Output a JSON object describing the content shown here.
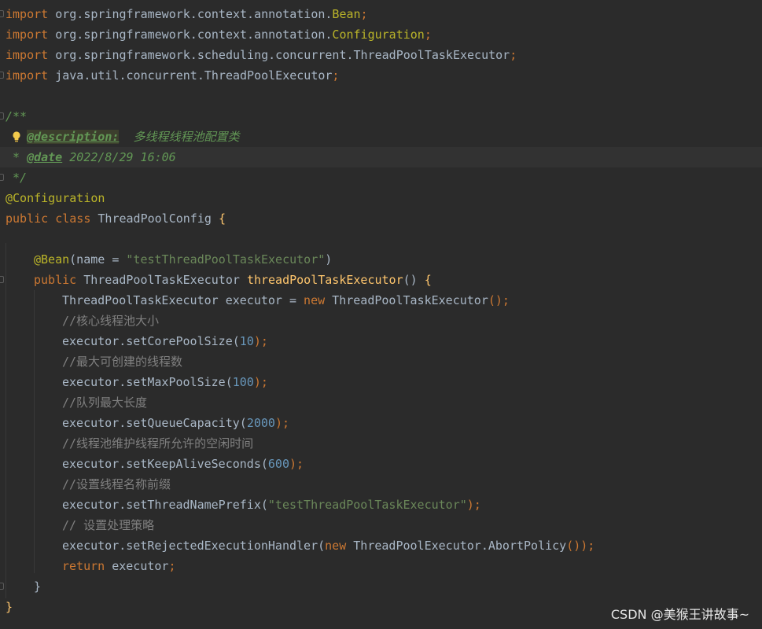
{
  "editor": {
    "language": "java",
    "lines": [
      [
        [
          "import",
          "kw"
        ],
        [
          " org.springframework.context.annotation.",
          "plain"
        ],
        [
          "Bean",
          "ann"
        ],
        [
          ";",
          "punc"
        ]
      ],
      [
        [
          "import",
          "kw"
        ],
        [
          " org.springframework.context.annotation.",
          "plain"
        ],
        [
          "Configuration",
          "ann"
        ],
        [
          ";",
          "punc"
        ]
      ],
      [
        [
          "import",
          "kw"
        ],
        [
          " org.springframework.scheduling.concurrent.ThreadPoolTaskExecutor",
          "plain"
        ],
        [
          ";",
          "punc"
        ]
      ],
      [
        [
          "import",
          "kw"
        ],
        [
          " java.util.concurrent.ThreadPoolExecutor",
          "plain"
        ],
        [
          ";",
          "punc"
        ]
      ],
      [],
      [
        [
          "/**",
          "doc"
        ]
      ],
      [
        [
          "@description:",
          "doctag boxed"
        ],
        [
          "  多线程线程池配置类",
          "doc"
        ]
      ],
      [
        [
          "* ",
          "doc"
        ],
        [
          "@date",
          "doctag"
        ],
        [
          " 2022/8/29 16:06",
          "doc"
        ]
      ],
      [
        [
          "*/",
          "doc"
        ]
      ],
      [
        [
          "@Configuration",
          "ann"
        ]
      ],
      [
        [
          "public class ",
          "kw"
        ],
        [
          "ThreadPoolConfig ",
          "plain"
        ],
        [
          "{",
          "fn"
        ]
      ],
      [],
      [
        [
          "@Bean",
          "ann"
        ],
        [
          "(name = ",
          "plain"
        ],
        [
          "\"testThreadPoolTaskExecutor\"",
          "str"
        ],
        [
          ")",
          "plain"
        ]
      ],
      [
        [
          "public ",
          "kw"
        ],
        [
          "ThreadPoolTaskExecutor ",
          "plain"
        ],
        [
          "threadPoolTaskExecutor",
          "fn"
        ],
        [
          "() ",
          "plain"
        ],
        [
          "{",
          "fn"
        ]
      ],
      [
        [
          "ThreadPoolTaskExecutor executor = ",
          "plain"
        ],
        [
          "new ",
          "kw"
        ],
        [
          "ThreadPoolTaskExecutor",
          "plain"
        ],
        [
          "();",
          "punc"
        ]
      ],
      [
        [
          "//核心线程池大小",
          "cmt"
        ]
      ],
      [
        [
          "executor.setCorePoolSize(",
          "plain"
        ],
        [
          "10",
          "num"
        ],
        [
          ");",
          "punc"
        ]
      ],
      [
        [
          "//最大可创建的线程数",
          "cmt"
        ]
      ],
      [
        [
          "executor.setMaxPoolSize(",
          "plain"
        ],
        [
          "100",
          "num"
        ],
        [
          ");",
          "punc"
        ]
      ],
      [
        [
          "//队列最大长度",
          "cmt"
        ]
      ],
      [
        [
          "executor.setQueueCapacity(",
          "plain"
        ],
        [
          "2000",
          "num"
        ],
        [
          ");",
          "punc"
        ]
      ],
      [
        [
          "//线程池维护线程所允许的空闲时间",
          "cmt"
        ]
      ],
      [
        [
          "executor.setKeepAliveSeconds(",
          "plain"
        ],
        [
          "600",
          "num"
        ],
        [
          ");",
          "punc"
        ]
      ],
      [
        [
          "//设置线程名称前缀",
          "cmt"
        ]
      ],
      [
        [
          "executor.setThreadNamePrefix(",
          "plain"
        ],
        [
          "\"testThreadPoolTaskExecutor\"",
          "str"
        ],
        [
          ");",
          "punc"
        ]
      ],
      [
        [
          "// 设置处理策略",
          "cmt"
        ]
      ],
      [
        [
          "executor.setRejectedExecutionHandler(",
          "plain"
        ],
        [
          "new ",
          "kw"
        ],
        [
          "ThreadPoolExecutor.AbortPolicy",
          "plain"
        ],
        [
          "());",
          "punc"
        ]
      ],
      [
        [
          "return ",
          "kw"
        ],
        [
          "executor",
          "plain"
        ],
        [
          ";",
          "punc"
        ]
      ],
      [
        [
          "}",
          "plain"
        ]
      ],
      [
        [
          "}",
          "fn"
        ]
      ]
    ]
  },
  "watermark": "CSDN @美猴王讲故事~"
}
